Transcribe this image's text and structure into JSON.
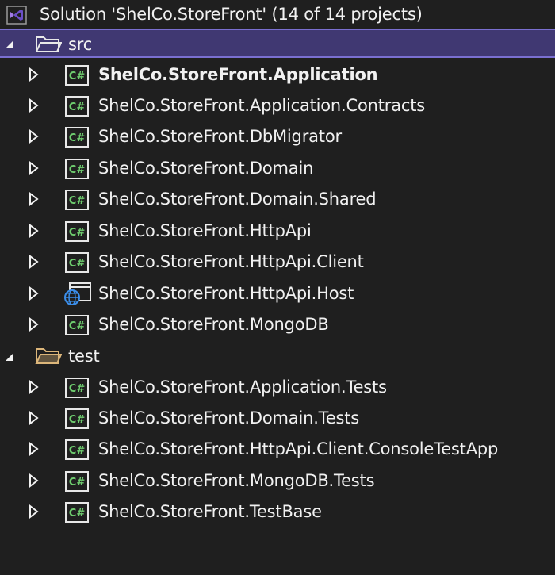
{
  "solution": {
    "label": "Solution 'ShelCo.StoreFront' (14 of 14 projects)",
    "icon": "visual-studio-solution-icon"
  },
  "folders": [
    {
      "name": "src",
      "icon": "folder-icon",
      "expanded": true,
      "selected": true,
      "projects": [
        {
          "label": "ShelCo.StoreFront.Application",
          "icon": "csharp-project-icon",
          "bold": true
        },
        {
          "label": "ShelCo.StoreFront.Application.Contracts",
          "icon": "csharp-project-icon"
        },
        {
          "label": "ShelCo.StoreFront.DbMigrator",
          "icon": "csharp-project-icon"
        },
        {
          "label": "ShelCo.StoreFront.Domain",
          "icon": "csharp-project-icon"
        },
        {
          "label": "ShelCo.StoreFront.Domain.Shared",
          "icon": "csharp-project-icon"
        },
        {
          "label": "ShelCo.StoreFront.HttpApi",
          "icon": "csharp-project-icon"
        },
        {
          "label": "ShelCo.StoreFront.HttpApi.Client",
          "icon": "csharp-project-icon"
        },
        {
          "label": "ShelCo.StoreFront.HttpApi.Host",
          "icon": "web-project-icon"
        },
        {
          "label": "ShelCo.StoreFront.MongoDB",
          "icon": "csharp-project-icon"
        }
      ]
    },
    {
      "name": "test",
      "icon": "folder-icon",
      "expanded": true,
      "selected": false,
      "projects": [
        {
          "label": "ShelCo.StoreFront.Application.Tests",
          "icon": "csharp-project-icon"
        },
        {
          "label": "ShelCo.StoreFront.Domain.Tests",
          "icon": "csharp-project-icon"
        },
        {
          "label": "ShelCo.StoreFront.HttpApi.Client.ConsoleTestApp",
          "icon": "csharp-project-icon"
        },
        {
          "label": "ShelCo.StoreFront.MongoDB.Tests",
          "icon": "csharp-project-icon"
        },
        {
          "label": "ShelCo.StoreFront.TestBase",
          "icon": "csharp-project-icon"
        }
      ]
    }
  ],
  "colors": {
    "background": "#1f1f1f",
    "selection": "#403872",
    "selection_border": "#7a6fd0",
    "csharp_green": "#6fce6f",
    "folder_yellow": "#dcb67a"
  },
  "glyphs": {
    "csharp": "C#"
  }
}
